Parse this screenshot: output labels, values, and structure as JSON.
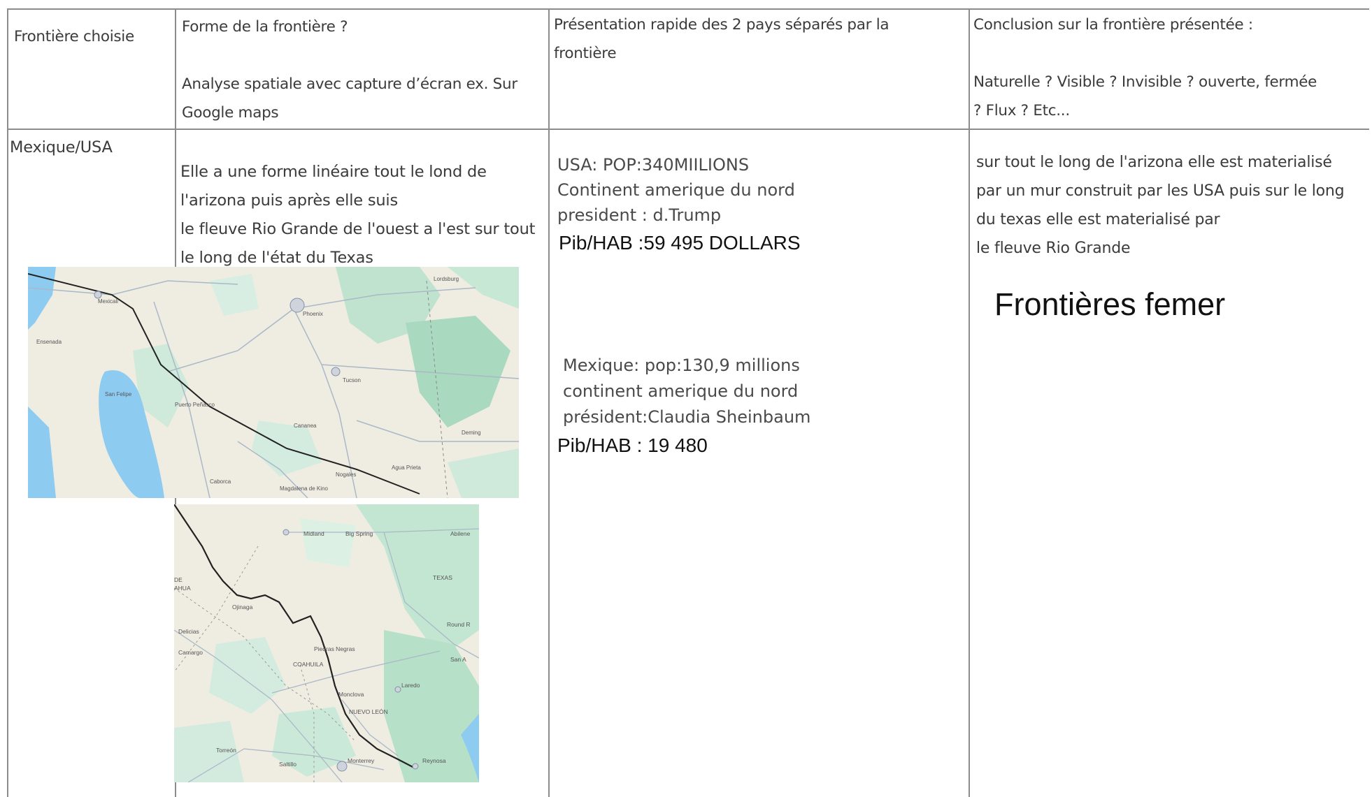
{
  "table": {
    "headers": [
      "Frontière choisie",
      "Forme de la frontière ?\n\nAnalyse spatiale avec capture d’écran ex. Sur\nGoogle maps",
      "Présentation rapide des 2 pays séparés par la\nfrontière",
      "Conclusion sur la frontière présentée :\n\nNaturelle ? Visible ? Invisible ? ouverte, fermée\n? Flux ? Etc..."
    ],
    "row": {
      "border": "Mexique/USA",
      "form": "Elle a une forme linéaire tout le lond de\nl'arizona puis après elle suis\nle fleuve Rio Grande de l'ouest a l'est sur tout\nle long de l'état du Texas",
      "usa": "USA:  POP:340MIILIONS\nContinent amerique du nord\n president : d.Trump",
      "usa_pib": "Pib/HAB :59 495 DOLLARS",
      "mexique": "Mexique: pop:130,9 millions\ncontinent amerique du nord\n président:Claudia Sheinbaum",
      "mexique_pib": "Pib/HAB : 19 480",
      "conclusion": "sur tout le long de l'arizona elle est materialisé\npar un mur construit par les USA puis sur le long\n du texas elle est materialisé par\nle fleuve Rio Grande",
      "conclusion_big": "Frontières femer"
    }
  },
  "map1": {
    "labels": [
      "Phoenix",
      "Mexicali",
      "Tucson",
      "Ensenada",
      "San Felipe",
      "Puerto Peñasco",
      "Cananea",
      "Nogales",
      "Agua Prieta",
      "Lordsburg",
      "Deming",
      "Caborca",
      "Magdalena de Kino"
    ]
  },
  "map2": {
    "labels": [
      "Midland",
      "Big Spring",
      "Abilene",
      "TEXAS",
      "Ojinaga",
      "Round R",
      "San A",
      "Camargo",
      "Delicias",
      "Piedras Negras",
      "COAHUILA",
      "Monclova",
      "Laredo",
      "NUEVO LEÓN",
      "Monterrey",
      "Saltillo",
      "Torreón",
      "Reynosa",
      "DE",
      "AHUA"
    ]
  },
  "colors": {
    "grid": "#8c8c8c",
    "map_land": "#efece2",
    "map_green": "#bfe3cf",
    "water": "#8ecbf0",
    "border_line": "#222222"
  }
}
